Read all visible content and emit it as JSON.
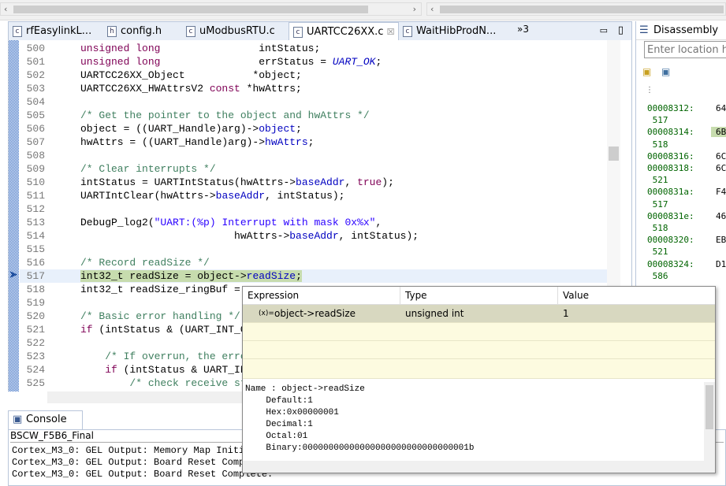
{
  "tabs": [
    {
      "label": "rfEasylinkL...",
      "icon": "c-file-icon",
      "glyph": "c"
    },
    {
      "label": "config.h",
      "icon": "h-file-icon",
      "glyph": "h"
    },
    {
      "label": "uModbusRTU.c",
      "icon": "c-file-icon",
      "glyph": "c"
    },
    {
      "label": "UARTCC26XX.c",
      "icon": "c-file-icon",
      "glyph": "c",
      "active": true
    },
    {
      "label": "WaitHibProdN...",
      "icon": "c-file-icon",
      "glyph": "c"
    }
  ],
  "tabs_overflow": "»3",
  "close_glyph": "☒",
  "code": [
    {
      "n": "500",
      "s": [
        [
          "unsigned long",
          "kw"
        ],
        [
          "                intStatus;",
          ""
        ]
      ]
    },
    {
      "n": "501",
      "s": [
        [
          "unsigned long",
          "kw"
        ],
        [
          "                errStatus = ",
          ""
        ],
        [
          "UART_OK",
          "mac"
        ],
        [
          ";",
          ""
        ]
      ]
    },
    {
      "n": "502",
      "s": [
        [
          "UARTCC26XX_Object           *object;",
          ""
        ]
      ]
    },
    {
      "n": "503",
      "s": [
        [
          "UARTCC26XX_HWAttrsV2 ",
          ""
        ],
        [
          "const",
          "kw"
        ],
        [
          " *hwAttrs;",
          ""
        ]
      ]
    },
    {
      "n": "504",
      "s": []
    },
    {
      "n": "505",
      "s": [
        [
          "/* Get the pointer to the object and hwAttrs */",
          "cm"
        ]
      ]
    },
    {
      "n": "506",
      "s": [
        [
          "object = ((UART_Handle)arg)->",
          ""
        ],
        [
          "object",
          "fld"
        ],
        [
          ";",
          ""
        ]
      ]
    },
    {
      "n": "507",
      "s": [
        [
          "hwAttrs = ((UART_Handle)arg)->",
          ""
        ],
        [
          "hwAttrs",
          "fld"
        ],
        [
          ";",
          ""
        ]
      ]
    },
    {
      "n": "508",
      "s": []
    },
    {
      "n": "509",
      "s": [
        [
          "/* Clear interrupts */",
          "cm"
        ]
      ]
    },
    {
      "n": "510",
      "s": [
        [
          "intStatus = UARTIntStatus(hwAttrs->",
          ""
        ],
        [
          "baseAddr",
          "fld"
        ],
        [
          ", ",
          ""
        ],
        [
          "true",
          "kw"
        ],
        [
          ");",
          ""
        ]
      ]
    },
    {
      "n": "511",
      "s": [
        [
          "UARTIntClear(hwAttrs->",
          ""
        ],
        [
          "baseAddr",
          "fld"
        ],
        [
          ", intStatus);",
          ""
        ]
      ]
    },
    {
      "n": "512",
      "s": []
    },
    {
      "n": "513",
      "s": [
        [
          "DebugP_log2(",
          ""
        ],
        [
          "\"UART:(%p) Interrupt with mask 0x%x\"",
          "str"
        ],
        [
          ",",
          ""
        ]
      ]
    },
    {
      "n": "514",
      "s": [
        [
          "                         hwAttrs->",
          ""
        ],
        [
          "baseAddr",
          "fld"
        ],
        [
          ", intStatus);",
          ""
        ]
      ]
    },
    {
      "n": "515",
      "s": []
    },
    {
      "n": "516",
      "s": [
        [
          "/* Record readSize */",
          "cm"
        ]
      ]
    },
    {
      "n": "517",
      "s": [
        [
          "int32_t readSize = object->",
          ""
        ],
        [
          "readSize",
          "fld"
        ],
        [
          ";",
          ""
        ]
      ],
      "current": true
    },
    {
      "n": "518",
      "s": [
        [
          "int32_t readSize_ringBuf = ",
          ""
        ]
      ]
    },
    {
      "n": "519",
      "s": []
    },
    {
      "n": "520",
      "s": [
        [
          "/* Basic error handling */",
          "cm"
        ]
      ]
    },
    {
      "n": "521",
      "s": [
        [
          "if",
          "kw"
        ],
        [
          " (intStatus & (UART_INT_O",
          ""
        ]
      ]
    },
    {
      "n": "522",
      "s": []
    },
    {
      "n": "523",
      "s": [
        [
          "    /* If overrun, the erro",
          "cm"
        ]
      ]
    },
    {
      "n": "524",
      "s": [
        [
          "    ",
          ""
        ],
        [
          "if",
          "kw"
        ],
        [
          " (intStatus & UART_IN",
          ""
        ]
      ]
    },
    {
      "n": "525",
      "s": [
        [
          "        /* check receive st",
          "cm"
        ]
      ]
    }
  ],
  "console": {
    "title": "Console",
    "session": "BSCW_F5B6_Final",
    "lines": [
      "Cortex_M3_0: GEL Output: Memory Map Initia",
      "Cortex_M3_0: GEL Output: Board Reset Compl",
      "Cortex_M3_0: GEL Output: Board Reset Complete."
    ]
  },
  "disassembly": {
    "title": "Disassembly",
    "location_placeholder": "Enter location her",
    "rows": [
      {
        "a": "00008312:",
        "h": "64"
      },
      {
        "a": " 517",
        "h": ""
      },
      {
        "a": "00008314:",
        "h": "6B",
        "current": true
      },
      {
        "a": " 518",
        "h": ""
      },
      {
        "a": "00008316:",
        "h": "6C"
      },
      {
        "a": "00008318:",
        "h": "6C"
      },
      {
        "a": " 521",
        "h": ""
      },
      {
        "a": "0000831a:",
        "h": "F4"
      },
      {
        "a": " 517",
        "h": ""
      },
      {
        "a": "0000831e:",
        "h": "46"
      },
      {
        "a": " 518",
        "h": ""
      },
      {
        "a": "00008320:",
        "h": "EB"
      },
      {
        "a": " 521",
        "h": ""
      },
      {
        "a": "00008324:",
        "h": "D1"
      },
      {
        "a": " 586",
        "h": ""
      }
    ]
  },
  "hover": {
    "columns": [
      "Expression",
      "Type",
      "Value"
    ],
    "row": {
      "expression": "object->readSize",
      "type": "unsigned int",
      "value": "1",
      "icon": "(x)="
    },
    "details": "Name : object->readSize\n    Default:1\n    Hex:0x00000001\n    Decimal:1\n    Octal:01\n    Binary:00000000000000000000000000000001b"
  }
}
